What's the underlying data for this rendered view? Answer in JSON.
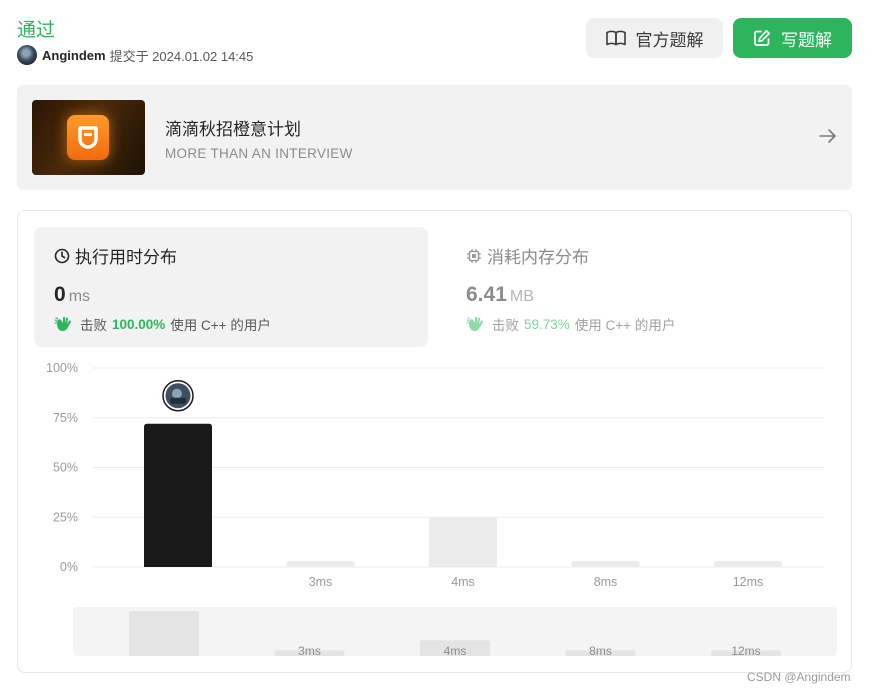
{
  "header": {
    "status": "通过",
    "submitter_name": "Angindem",
    "submitted_text": "提交于 2024.01.02 14:45"
  },
  "buttons": {
    "official_solution": "官方题解",
    "write_solution": "写题解"
  },
  "banner": {
    "title": "滴滴秋招橙意计划",
    "subtitle": "MORE THAN AN INTERVIEW"
  },
  "runtime": {
    "label": "执行用时分布",
    "value": "0",
    "unit": "ms",
    "beats_prefix": "击败",
    "beats_percent": "100.00%",
    "beats_suffix": "使用 C++ 的用户"
  },
  "memory": {
    "label": "消耗内存分布",
    "value": "6.41",
    "unit": "MB",
    "beats_prefix": "击败",
    "beats_percent": "59.73%",
    "beats_suffix": "使用 C++ 的用户"
  },
  "colors": {
    "accent_green": "#2db55d",
    "active_bar": "#1a1a1a",
    "inactive_bar": "#ebebeb"
  },
  "chart_data": {
    "type": "bar",
    "ylabel_ticks": [
      "100%",
      "75%",
      "50%",
      "25%",
      "0%"
    ],
    "ylim": [
      0,
      100
    ],
    "grid": true,
    "categories": [
      "",
      "3ms",
      "4ms",
      "8ms",
      "12ms"
    ],
    "values": [
      72,
      3,
      25,
      3,
      3
    ],
    "highlight_index": 0,
    "overview": {
      "categories": [
        "",
        "3ms",
        "4ms",
        "8ms",
        "12ms"
      ],
      "values": [
        72,
        3,
        25,
        3,
        3
      ]
    }
  },
  "watermark": "CSDN @Angindem"
}
